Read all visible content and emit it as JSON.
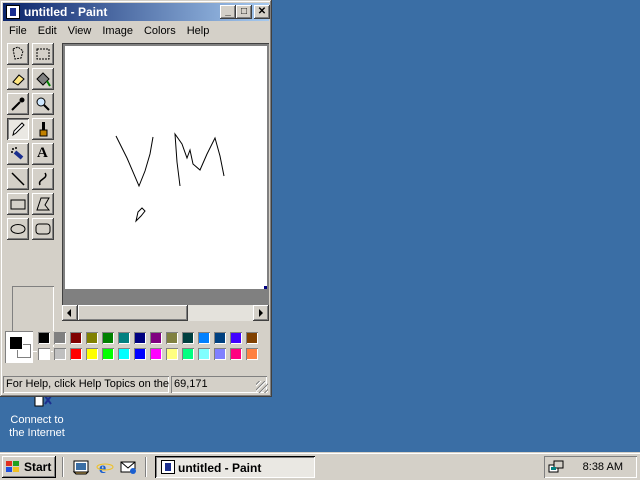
{
  "window": {
    "title": "untitled - Paint",
    "buttons": {
      "minimize": "_",
      "maximize": "□",
      "close": "✕"
    }
  },
  "menu": [
    "File",
    "Edit",
    "View",
    "Image",
    "Colors",
    "Help"
  ],
  "toolbox": {
    "tools": [
      "free-form-select",
      "select",
      "eraser",
      "fill-with-color",
      "pick-color",
      "magnifier",
      "pencil",
      "brush",
      "airbrush",
      "text",
      "line",
      "curve",
      "rectangle",
      "polygon",
      "ellipse",
      "rounded-rectangle"
    ],
    "selected": "pencil",
    "text_tool_glyph": "A"
  },
  "palette": {
    "foreground": "#000000",
    "background": "#ffffff",
    "colors_top": [
      "#000000",
      "#808080",
      "#800000",
      "#808000",
      "#008000",
      "#008080",
      "#000080",
      "#800080",
      "#808040",
      "#004040",
      "#0080ff",
      "#004080",
      "#4000ff",
      "#804000"
    ],
    "colors_bottom": [
      "#ffffff",
      "#c0c0c0",
      "#ff0000",
      "#ffff00",
      "#00ff00",
      "#00ffff",
      "#0000ff",
      "#ff00ff",
      "#ffff80",
      "#00ff80",
      "#80ffff",
      "#8080ff",
      "#ff0080",
      "#ff8040"
    ]
  },
  "status": {
    "help": "For Help, click Help Topics on the Help Menu.",
    "coords": "69,171"
  },
  "desktop_icon": {
    "label_line1": "Connect to",
    "label_line2": "the Internet"
  },
  "taskbar": {
    "start_label": "Start",
    "task_label": "untitled - Paint",
    "clock": "8:38 AM"
  }
}
